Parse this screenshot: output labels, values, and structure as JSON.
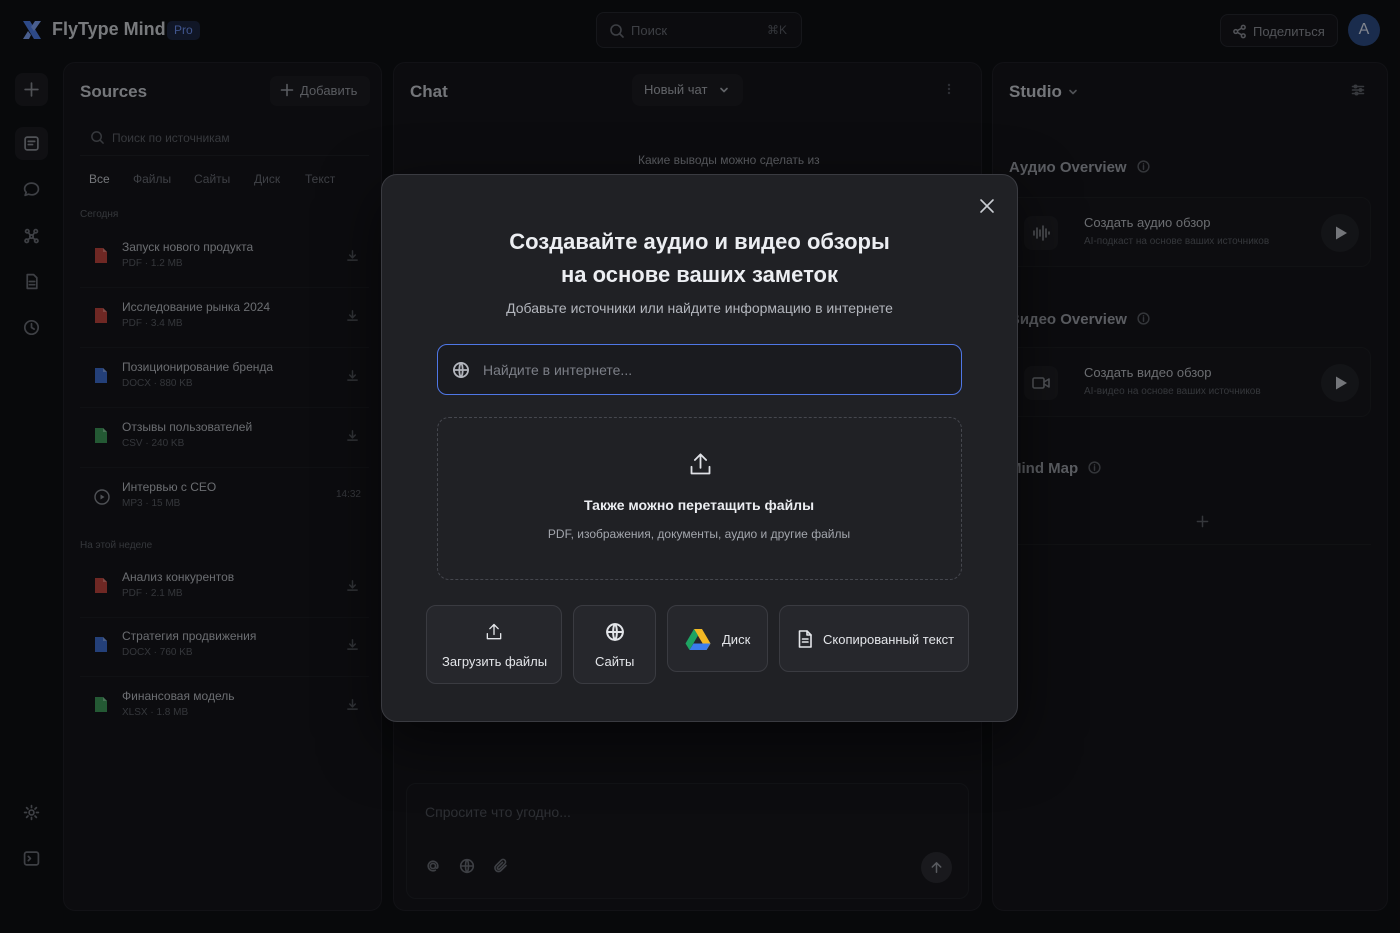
{
  "app": {
    "title": "FlyType Mind",
    "badge": "Pro"
  },
  "topbar": {
    "search_placeholder": "Поиск",
    "search_shortcut": "⌘K",
    "share_label": "Поделиться",
    "avatar_letter": "A"
  },
  "rail": {
    "icons": [
      "plus-icon",
      "notes-icon",
      "chat-icon",
      "graph-icon",
      "document-icon",
      "history-icon",
      "settings-icon",
      "terminal-icon"
    ]
  },
  "sources": {
    "title": "Sources",
    "add_label": "Добавить",
    "search_placeholder": "Поиск по источникам",
    "filters": [
      "Все",
      "Файлы",
      "Сайты",
      "Диск",
      "Текст"
    ],
    "active_filter": "Все",
    "group_today": "Сегодня",
    "group_week": "На этой неделе",
    "items": [
      {
        "name": "Запуск нового продукта",
        "type": "PDF",
        "size": "1.2 MB",
        "color": "#c0463f"
      },
      {
        "name": "Исследование рынка 2024",
        "type": "PDF",
        "size": "3.4 MB",
        "color": "#c0463f"
      },
      {
        "name": "Позиционирование бренда",
        "type": "DOCX",
        "size": "880 KB",
        "color": "#3e6fd0"
      },
      {
        "name": "Отзывы пользователей",
        "type": "CSV",
        "size": "240 KB",
        "color": "#3f9a5a"
      },
      {
        "name": "Интервью с CEO",
        "type": "MP3",
        "size": "15 MB",
        "duration": "14:32",
        "color": "#8a8d95"
      },
      {
        "name": "Анализ конкурентов",
        "type": "PDF",
        "size": "2.1 MB",
        "color": "#c0463f"
      },
      {
        "name": "Стратегия продвижения",
        "type": "DOCX",
        "size": "760 KB",
        "color": "#3e6fd0"
      },
      {
        "name": "Финансовая модель",
        "type": "XLSX",
        "size": "1.8 MB",
        "color": "#3f9a5a"
      }
    ]
  },
  "chat": {
    "title": "Chat",
    "new_chat_label": "Новый чат",
    "suggestion": "Какие выводы можно сделать из",
    "composer_placeholder": "Спросите что угодно..."
  },
  "studio": {
    "title": "Studio",
    "audio_section": "Аудио Overview",
    "video_section": "Видео Overview",
    "mindmap_section": "Mind Map",
    "audio_card": {
      "title": "Создать аудио обзор",
      "subtitle": "AI-подкаст на основе ваших источников"
    },
    "video_card": {
      "title": "Создать видео обзор",
      "subtitle": "AI-видео на основе ваших источников"
    }
  },
  "modal": {
    "title_line1": "Создавайте аудио и видео обзоры",
    "title_line2": "на основе ваших заметок",
    "subtitle": "Добавьте источники или найдите информацию в интернете",
    "search_placeholder": "Найдите в интернете...",
    "dropzone_title": "Также можно перетащить файлы",
    "dropzone_subtitle": "PDF, изображения, документы, аудио и другие файлы",
    "buttons": {
      "upload": "Загрузить файлы",
      "sites": "Сайты",
      "drive": "Диск",
      "text": "Скопированный текст"
    }
  },
  "colors": {
    "accent": "#4f77e6",
    "background": "#0f1013",
    "panel": "#15161a",
    "modal": "#202125"
  }
}
